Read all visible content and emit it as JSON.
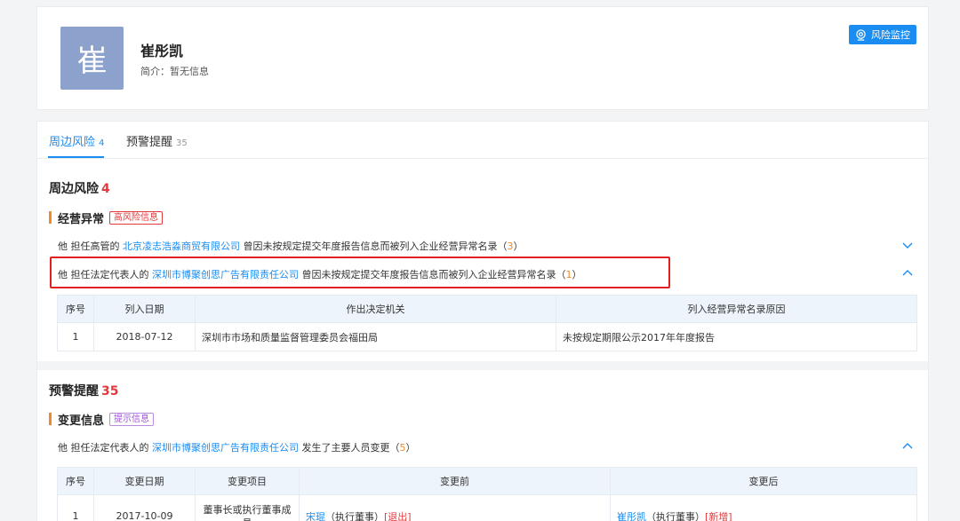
{
  "person": {
    "avatar_char": "崔",
    "name": "崔彤凯",
    "intro": "简介：暂无信息"
  },
  "monitor_button": {
    "label": "风险监控",
    "icon": "radar-icon"
  },
  "tabs": [
    {
      "label": "周边风险",
      "count": "4"
    },
    {
      "label": "预警提醒",
      "count": "35"
    }
  ],
  "risk_section": {
    "title": "周边风险",
    "count": "4",
    "category": {
      "label": "经营异常",
      "tag": "高风险信息"
    },
    "items": [
      {
        "prefix": "他 担任高管的 ",
        "company": "北京凌志浩淼商贸有限公司",
        "suffix": " 曾因未按规定提交年度报告信息而被列入企业经营异常名录（",
        "count": "3",
        "close": "）"
      },
      {
        "prefix": "他 担任法定代表人的 ",
        "company": "深圳市博聚创思广告有限责任公司",
        "suffix": " 曾因未按规定提交年度报告信息而被列入企业经营异常名录（",
        "count": "1",
        "close": "）"
      }
    ],
    "table": {
      "headers": [
        "序号",
        "列入日期",
        "作出决定机关",
        "列入经营异常名录原因"
      ],
      "rows": [
        [
          "1",
          "2018-07-12",
          "深圳市市场和质量监督管理委员会福田局",
          "未按规定期限公示2017年年度报告"
        ]
      ]
    }
  },
  "warning_section": {
    "title": "预警提醒",
    "count": "35",
    "category": {
      "label": "变更信息",
      "tag": "提示信息"
    },
    "item": {
      "prefix": "他 担任法定代表人的 ",
      "company": "深圳市博聚创思广告有限责任公司",
      "suffix": " 发生了主要人员变更（",
      "count": "5",
      "close": "）"
    },
    "table": {
      "headers": [
        "序号",
        "变更日期",
        "变更项目",
        "变更前",
        "变更后"
      ],
      "rows": [
        {
          "no": "1",
          "date": "2017-10-09",
          "item": "董事长或执行董事成员",
          "before_name": "宋琨",
          "before_role": "（执行董事）",
          "before_op": "[退出]",
          "after_name": "崔彤凯",
          "after_role": "（执行董事）",
          "after_op": "[新增]"
        }
      ]
    }
  },
  "colors": {
    "accent": "#1b8cf0",
    "danger": "#e4393c",
    "orange": "#f08a24",
    "highlight": "#e02020"
  }
}
